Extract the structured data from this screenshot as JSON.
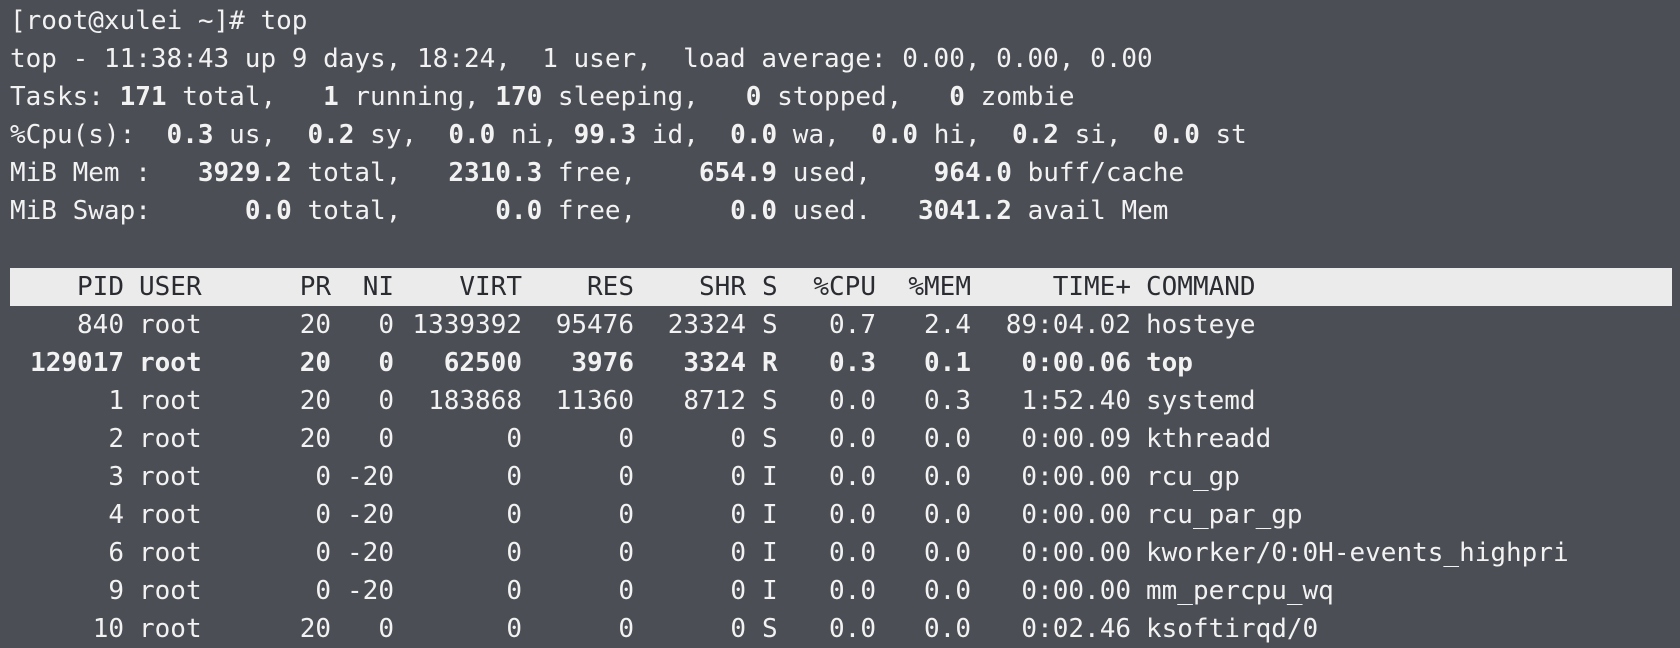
{
  "prompt": {
    "text": "[root@xulei ~]# top"
  },
  "summary": {
    "top_line": {
      "time": "top - 11:38:43 up 9 days, 18:24,  1 user,  load average: 0.00, 0.00, 0.00"
    },
    "tasks": {
      "label": "Tasks:",
      "total": "171",
      "total_label": "total,",
      "running": "1",
      "running_label": "running,",
      "sleeping": "170",
      "sleeping_label": "sleeping,",
      "stopped": "0",
      "stopped_label": "stopped,",
      "zombie": "0",
      "zombie_label": "zombie"
    },
    "cpu": {
      "label": "%Cpu(s):",
      "us": "0.3",
      "us_label": "us,",
      "sy": "0.2",
      "sy_label": "sy,",
      "ni": "0.0",
      "ni_label": "ni,",
      "id": "99.3",
      "id_label": "id,",
      "wa": "0.0",
      "wa_label": "wa,",
      "hi": "0.0",
      "hi_label": "hi,",
      "si": "0.2",
      "si_label": "si,",
      "st": "0.0",
      "st_label": "st"
    },
    "mem": {
      "label": "MiB Mem :",
      "total": "3929.2",
      "total_label": "total,",
      "free": "2310.3",
      "free_label": "free,",
      "used": "654.9",
      "used_label": "used,",
      "buff": "964.0",
      "buff_label": "buff/cache"
    },
    "swap": {
      "label": "MiB Swap:",
      "total": "0.0",
      "total_label": "total,",
      "free": "0.0",
      "free_label": "free,",
      "used": "0.0",
      "used_label": "used.",
      "avail": "3041.2",
      "avail_label": "avail Mem"
    }
  },
  "table": {
    "headers": [
      "PID",
      "USER",
      "PR",
      "NI",
      "VIRT",
      "RES",
      "SHR",
      "S",
      "%CPU",
      "%MEM",
      "TIME+",
      "COMMAND"
    ],
    "rows": [
      [
        "840",
        "root",
        "20",
        "0",
        "1339392",
        "95476",
        "23324",
        "S",
        "0.7",
        "2.4",
        "89:04.02",
        "hosteye"
      ],
      [
        "129017",
        "root",
        "20",
        "0",
        "62500",
        "3976",
        "3324",
        "R",
        "0.3",
        "0.1",
        "0:00.06",
        "top"
      ],
      [
        "1",
        "root",
        "20",
        "0",
        "183868",
        "11360",
        "8712",
        "S",
        "0.0",
        "0.3",
        "1:52.40",
        "systemd"
      ],
      [
        "2",
        "root",
        "20",
        "0",
        "0",
        "0",
        "0",
        "S",
        "0.0",
        "0.0",
        "0:00.09",
        "kthreadd"
      ],
      [
        "3",
        "root",
        "0",
        "-20",
        "0",
        "0",
        "0",
        "I",
        "0.0",
        "0.0",
        "0:00.00",
        "rcu_gp"
      ],
      [
        "4",
        "root",
        "0",
        "-20",
        "0",
        "0",
        "0",
        "I",
        "0.0",
        "0.0",
        "0:00.00",
        "rcu_par_gp"
      ],
      [
        "6",
        "root",
        "0",
        "-20",
        "0",
        "0",
        "0",
        "I",
        "0.0",
        "0.0",
        "0:00.00",
        "kworker/0:0H-events_highpri"
      ],
      [
        "9",
        "root",
        "0",
        "-20",
        "0",
        "0",
        "0",
        "I",
        "0.0",
        "0.0",
        "0:00.00",
        "mm_percpu_wq"
      ],
      [
        "10",
        "root",
        "20",
        "0",
        "0",
        "0",
        "0",
        "S",
        "0.0",
        "0.0",
        "0:02.46",
        "ksoftirqd/0"
      ]
    ],
    "highlighted_row": 1
  },
  "colors": {
    "background": "#4b4e55",
    "foreground": "#f2f2f2",
    "header_bg": "#ebebeb",
    "header_fg": "#2a2c31"
  }
}
